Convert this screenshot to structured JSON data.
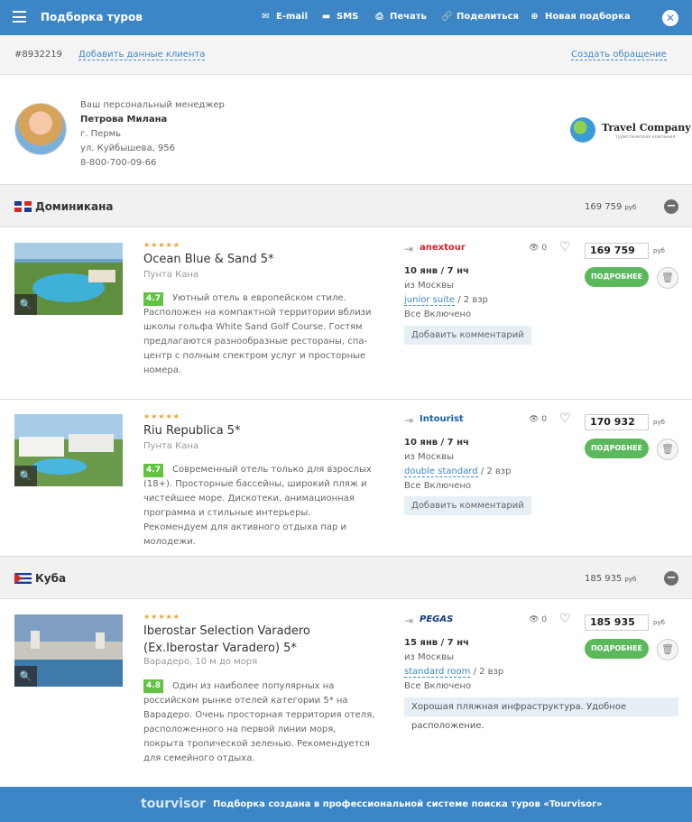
{
  "topbar": {
    "title": "Подборка туров",
    "actions": [
      {
        "label": "E-mail",
        "icon": "email-icon"
      },
      {
        "label": "SMS",
        "icon": "sms-icon"
      },
      {
        "label": "Печать",
        "icon": "print-icon"
      },
      {
        "label": "Поделиться",
        "icon": "share-icon"
      },
      {
        "label": "Новая подборка",
        "icon": "plus-icon"
      }
    ],
    "accent": "#3d86c6"
  },
  "client": {
    "id": "#8932219",
    "add_client_link": "Добавить данные клиента",
    "create_request_link": "Создать обращение"
  },
  "manager": {
    "caption": "Ваш персональный менеджер",
    "name": "Петрова Милана",
    "city": "г. Пермь",
    "address": "ул. Куйбышева, 956",
    "phone": "8-800-700-09-66",
    "company": "Travel Company",
    "company_sub": "туристическая компания"
  },
  "countries": [
    {
      "name": "Доминикана",
      "total": "169 759",
      "currency": "руб",
      "tours": [
        {
          "stars": "★★★★★",
          "hotel": "Ocean Blue & Sand 5*",
          "location": "Пунта Кана",
          "rating": "4.7",
          "description": "Уютный отель в европейском стиле. Расположен на компактной территории вблизи школы гольфа White Sand Golf Course. Гостям предлагаются разнообразные рестораны, спа-центр с полным спектром услуг и просторные номера.",
          "operator": "anextour",
          "dates": "10 янв / 7 нч",
          "departure": "из Москвы",
          "room": "junior suite",
          "guests": "/ 2 взр",
          "meal": "Все Включено",
          "comment": "Добавить комментарий",
          "views": "0",
          "price": "169 759",
          "currency": "руб",
          "more": "ПОДРОБНЕЕ"
        },
        {
          "stars": "★★★★★",
          "hotel": "Riu Republica 5*",
          "location": "Пунта Кана",
          "rating": "4.7",
          "description": "Современный отель только для взрослых (18+). Просторные бассейны, широкий пляж и чистейшее море. Дискотеки, анимационная программа и стильные интерьеры. Рекомендуем для активного отдыха пар и молодежи.",
          "operator": "Intourist",
          "dates": "10 янв / 7 нч",
          "departure": "из Москвы",
          "room": "double standard",
          "guests": "/ 2 взр",
          "meal": "Все Включено",
          "comment": "Добавить комментарий",
          "views": "0",
          "price": "170 932",
          "currency": "руб",
          "more": "ПОДРОБНЕЕ"
        }
      ]
    },
    {
      "name": "Куба",
      "total": "185 935",
      "currency": "руб",
      "tours": [
        {
          "stars": "★★★★★",
          "hotel": "Iberostar Selection Varadero (Ex.Iberostar Varadero) 5*",
          "location": "Варадеро, 10 м до моря",
          "rating": "4.8",
          "description": "Один из наиболее популярных на российском рынке отелей категории 5* на Варадеро. Очень просторная территория отеля, расположенного на первой линии моря, покрыта тропической зеленью. Рекомендуется для семейного отдыха.",
          "operator": "PEGAS",
          "dates": "15 янв / 7 нч",
          "departure": "из Москвы",
          "room": "standard room",
          "guests": "/ 2 взр",
          "meal": "Все Включено",
          "comment": "Хорошая пляжная инфраструктура. Удобное расположение.",
          "views": "0",
          "price": "185 935",
          "currency": "руб",
          "more": "ПОДРОБНЕЕ"
        }
      ]
    }
  ],
  "footer": {
    "brand": "tourvisor",
    "text": "Подборка создана в профессиональной системе поиска туров «Tourvisor»"
  }
}
